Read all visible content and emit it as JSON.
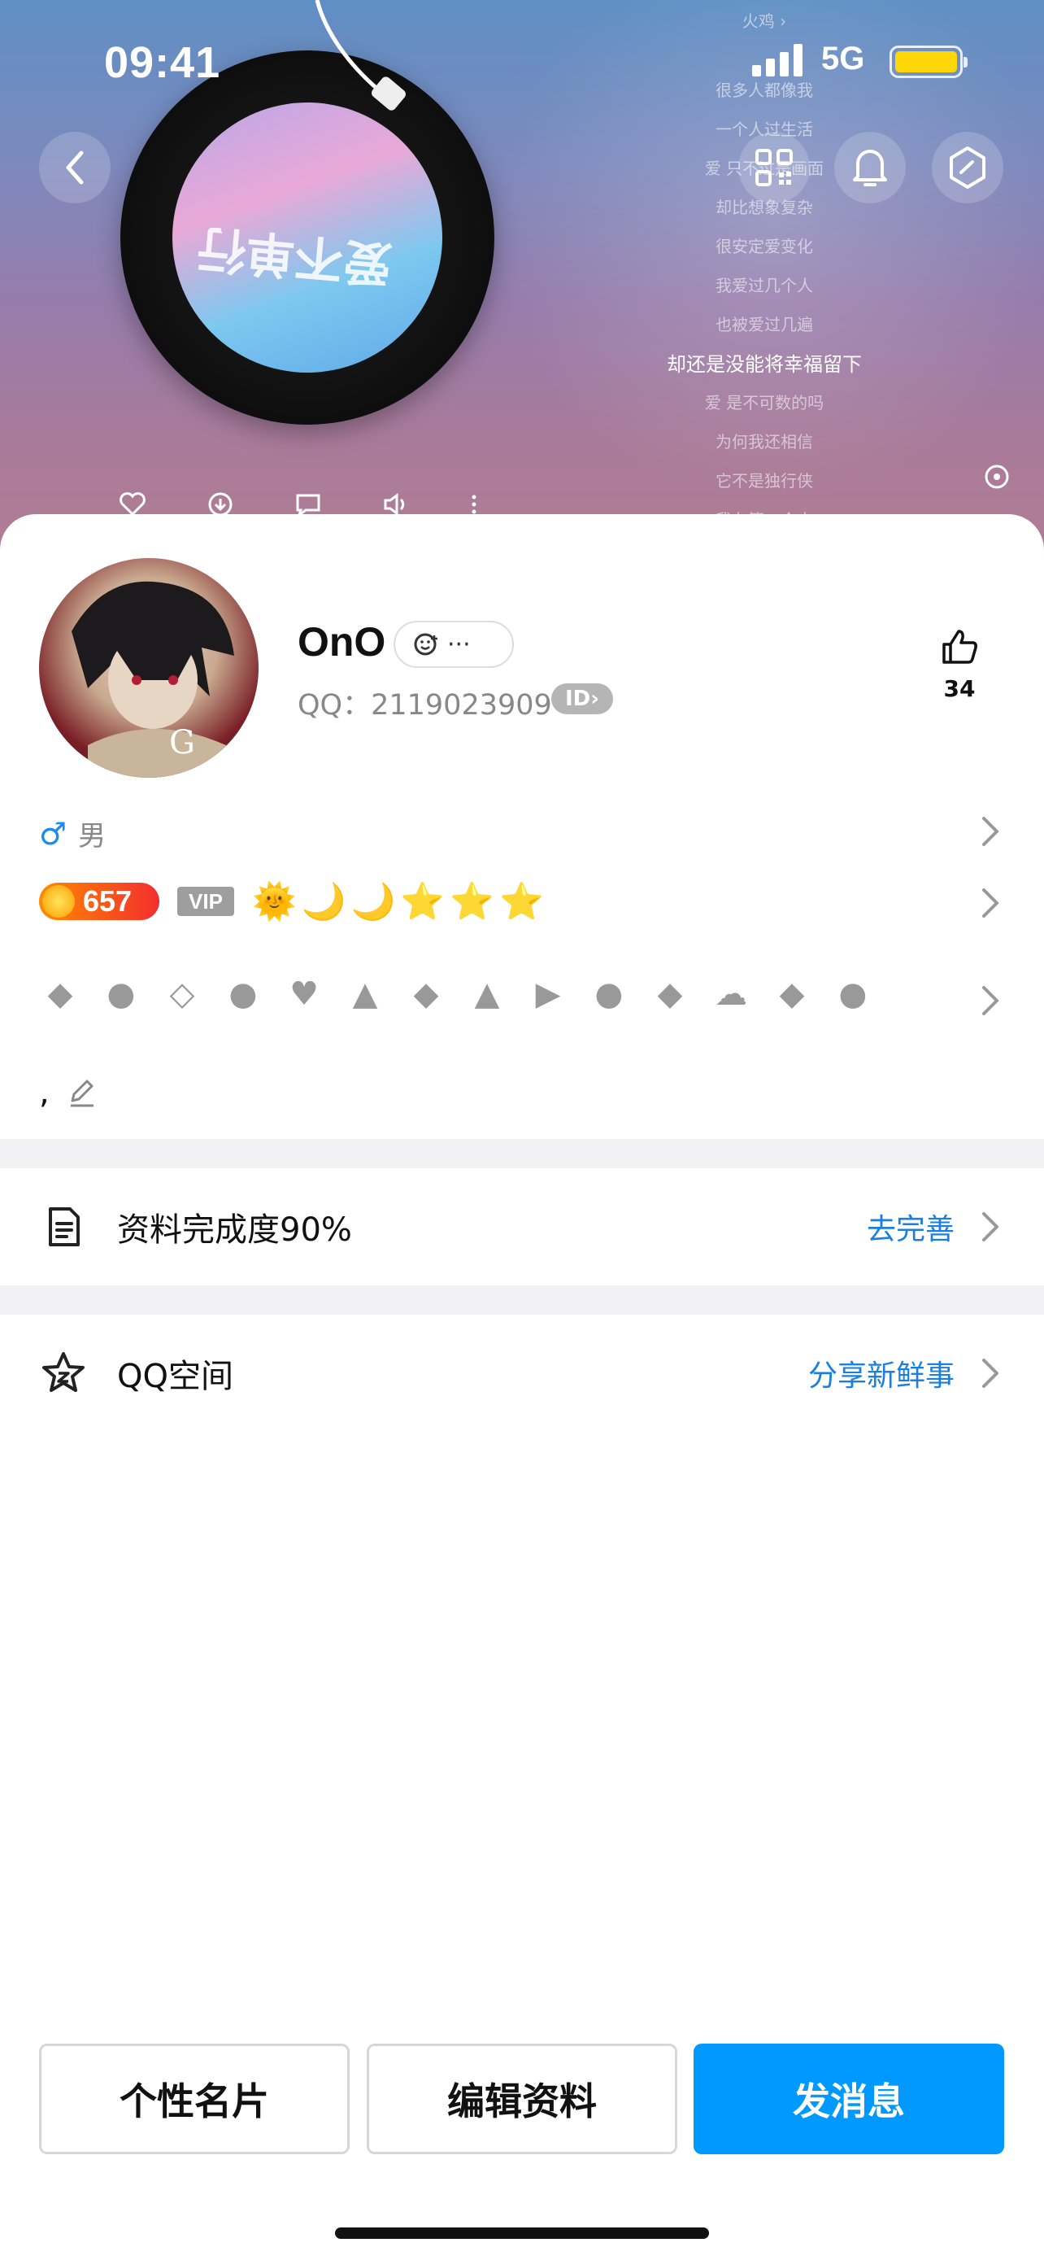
{
  "status_bar": {
    "time": "09:41",
    "network": "5G"
  },
  "music": {
    "artist_link": "火鸡 ›",
    "lyrics": [
      "很多人都像我",
      "一个人过生活",
      "爱 只不过是画面",
      "却比想象复杂",
      "很安定爱变化",
      "我爱过几个人",
      "也被爱过几遍",
      "却还是没能将幸福留下",
      "爱 是不可数的吗",
      "为何我还相信",
      "它不是独行侠",
      "我在等一个人"
    ],
    "current_line": "却还是没能将幸福留下",
    "album_text": "爱不单行"
  },
  "profile": {
    "name": "OnO",
    "status_label": "···",
    "qq_label": "QQ：2119023909",
    "id_badge": "ID›",
    "like_count": "34",
    "gender": "男",
    "level": "657",
    "vip": "VIP",
    "signature": ","
  },
  "rows": {
    "completeness": {
      "label": "资料完成度90%",
      "action": "去完善"
    },
    "qzone": {
      "label": "QQ空间",
      "action": "分享新鲜事"
    }
  },
  "buttons": {
    "card": "个性名片",
    "edit": "编辑资料",
    "message": "发消息"
  },
  "colors": {
    "accent": "#0099ff",
    "link": "#1a7fe0",
    "level": "#f42e2e"
  }
}
